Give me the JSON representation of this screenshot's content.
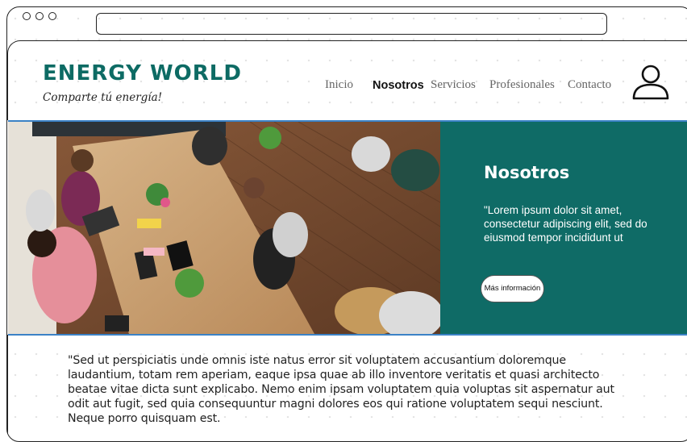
{
  "header": {
    "brand": "ENERGY WORLD",
    "tagline": "Comparte tú energía!"
  },
  "nav": {
    "items": [
      "Inicio",
      "Nosotros",
      "Servicios",
      "Profesionales",
      "Contacto"
    ],
    "active": "Nosotros"
  },
  "hero": {
    "heading": "Nosotros",
    "text": "\"Lorem ipsum dolor sit amet, consectetur adipiscing elit, sed do eiusmod tempor incididunt ut",
    "button_label": "Más información"
  },
  "body": {
    "paragraph": "\"Sed ut perspiciatis unde omnis iste natus error sit voluptatem accusantium doloremque laudantium, totam rem aperiam, eaque ipsa quae ab illo inventore veritatis et quasi architecto beatae vitae dicta sunt explicabo. Nemo enim ipsam voluptatem quia voluptas sit aspernatur aut odit aut fugit, sed quia consequuntur magni dolores eos qui ratione voluptatem sequi nesciunt. Neque porro quisquam est."
  },
  "icons": {
    "user": "user-icon",
    "window_controls": "window-dot-icon"
  },
  "colors": {
    "brand": "#0d6b64",
    "hero_panel": "#0f6b66",
    "hero_border": "#3b82c6"
  }
}
